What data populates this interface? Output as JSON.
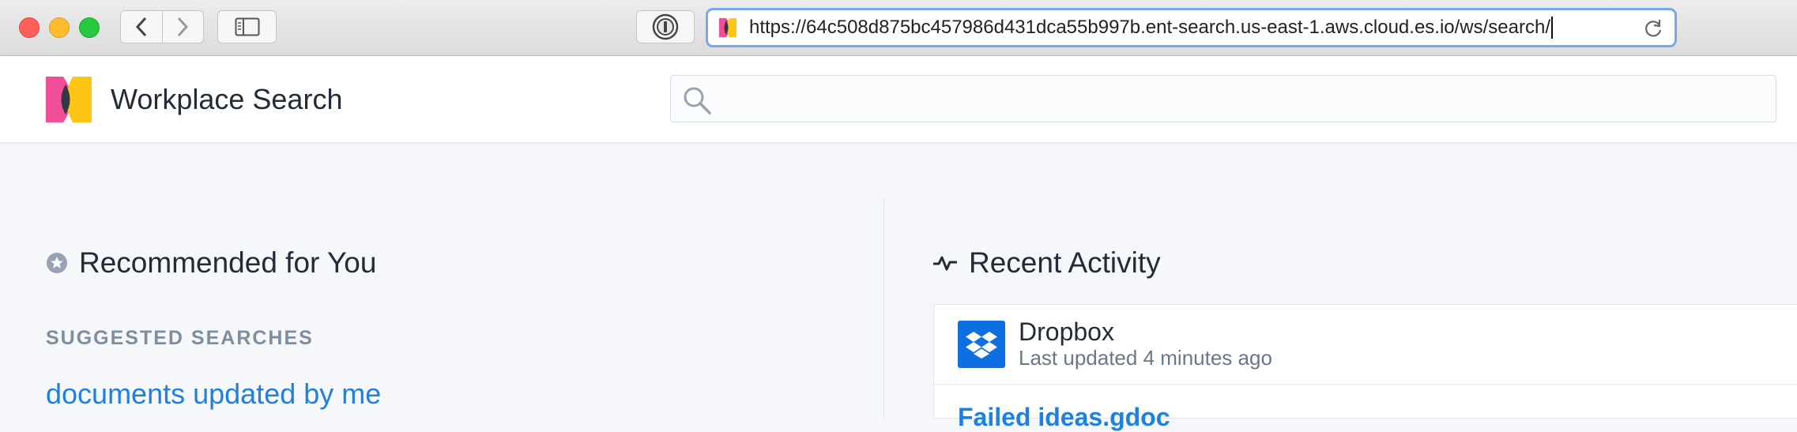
{
  "browser": {
    "url": "https://64c508d875bc457986d431dca55b997b.ent-search.us-east-1.aws.cloud.es.io/ws/search/"
  },
  "header": {
    "app_title": "Workplace Search",
    "search_value": ""
  },
  "recommended": {
    "title": "Recommended for You",
    "suggested_label": "SUGGESTED SEARCHES",
    "suggestions": [
      "documents updated by me"
    ]
  },
  "activity": {
    "title": "Recent Activity",
    "source": "Dropbox",
    "updated": "Last updated 4 minutes ago",
    "first_item": "Failed ideas.gdoc"
  }
}
